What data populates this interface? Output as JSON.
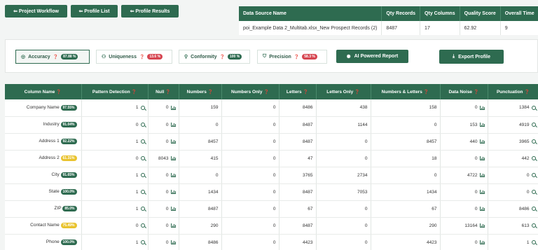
{
  "nav": {
    "project_workflow": "⇐ Project Workflow",
    "profile_list": "⇐ Profile List",
    "profile_results": "⇐ Profile Results"
  },
  "datasource": {
    "headers": [
      "Data Source Name",
      "Qty Records",
      "Qty Columns",
      "Quality Score",
      "Overall Time"
    ],
    "row": [
      "poi_Example Data 2_Multitab.xlsx_New Prospect Records (2)",
      "8487",
      "17",
      "62.92",
      "9"
    ]
  },
  "metrics": {
    "accuracy": {
      "label": "Accuracy",
      "value": "87.88 %",
      "icon": "target-icon"
    },
    "uniqueness": {
      "label": "Uniqueness",
      "value": "13.6 %",
      "icon": "users-icon"
    },
    "conformity": {
      "label": "Conformity",
      "value": "100 %",
      "icon": "user-check-icon"
    },
    "precision": {
      "label": "Precision",
      "value": "58.3 %",
      "icon": "shield-icon"
    },
    "ai_report": "AI Powered Report",
    "export": "Export Profile"
  },
  "colors": {
    "primary": "#2e6b50",
    "red": "#d64550",
    "yellow": "#e9c32e"
  },
  "table": {
    "headers": [
      "Column Name",
      "Pattern Detection",
      "Null",
      "Numbers",
      "Numbers Only",
      "Letters",
      "Letters Only",
      "Numbers & Letters",
      "Data Noise",
      "Punctuation"
    ],
    "rows": [
      {
        "name": "Company Name",
        "badge": "97.55%",
        "badge_color": "green",
        "pattern": "1",
        "null": "0",
        "numbers": "159",
        "numbers_only": "0",
        "letters": "8486",
        "letters_only": "438",
        "num_letters": "158",
        "noise": "0",
        "punct": "1384"
      },
      {
        "name": "Industry",
        "badge": "91.04%",
        "badge_color": "green",
        "pattern": "0",
        "null": "0",
        "numbers": "0",
        "numbers_only": "0",
        "letters": "8487",
        "letters_only": "1144",
        "num_letters": "0",
        "noise": "153",
        "punct": "4919"
      },
      {
        "name": "Address 1",
        "badge": "92.22%",
        "badge_color": "green",
        "pattern": "1",
        "null": "0",
        "numbers": "8457",
        "numbers_only": "0",
        "letters": "8487",
        "letters_only": "0",
        "num_letters": "8457",
        "noise": "440",
        "punct": "3965"
      },
      {
        "name": "Address 2",
        "badge": "61.31%",
        "badge_color": "yellow",
        "pattern": "0",
        "null": "8043",
        "numbers": "415",
        "numbers_only": "0",
        "letters": "47",
        "letters_only": "0",
        "num_letters": "18",
        "noise": "0",
        "punct": "442"
      },
      {
        "name": "City",
        "badge": "91.65%",
        "badge_color": "green",
        "pattern": "1",
        "null": "0",
        "numbers": "0",
        "numbers_only": "0",
        "letters": "3765",
        "letters_only": "2734",
        "num_letters": "0",
        "noise": "4722",
        "punct": "0"
      },
      {
        "name": "State",
        "badge": "100.0%",
        "badge_color": "green",
        "pattern": "1",
        "null": "0",
        "numbers": "1434",
        "numbers_only": "0",
        "letters": "8487",
        "letters_only": "7053",
        "num_letters": "1434",
        "noise": "0",
        "punct": "0"
      },
      {
        "name": "ZIP",
        "badge": "85.0%",
        "badge_color": "green",
        "pattern": "1",
        "null": "0",
        "numbers": "8487",
        "numbers_only": "0",
        "letters": "67",
        "letters_only": "0",
        "num_letters": "67",
        "noise": "0",
        "punct": "8486"
      },
      {
        "name": "Contact Name",
        "badge": "75.49%",
        "badge_color": "yellow",
        "pattern": "0",
        "null": "0",
        "numbers": "290",
        "numbers_only": "0",
        "letters": "8487",
        "letters_only": "0",
        "num_letters": "290",
        "noise": "13164",
        "punct": "613"
      },
      {
        "name": "Phone",
        "badge": "100.0%",
        "badge_color": "green",
        "pattern": "1",
        "null": "0",
        "numbers": "8486",
        "numbers_only": "0",
        "letters": "4423",
        "letters_only": "0",
        "num_letters": "4423",
        "noise": "0",
        "punct": "1"
      }
    ]
  }
}
